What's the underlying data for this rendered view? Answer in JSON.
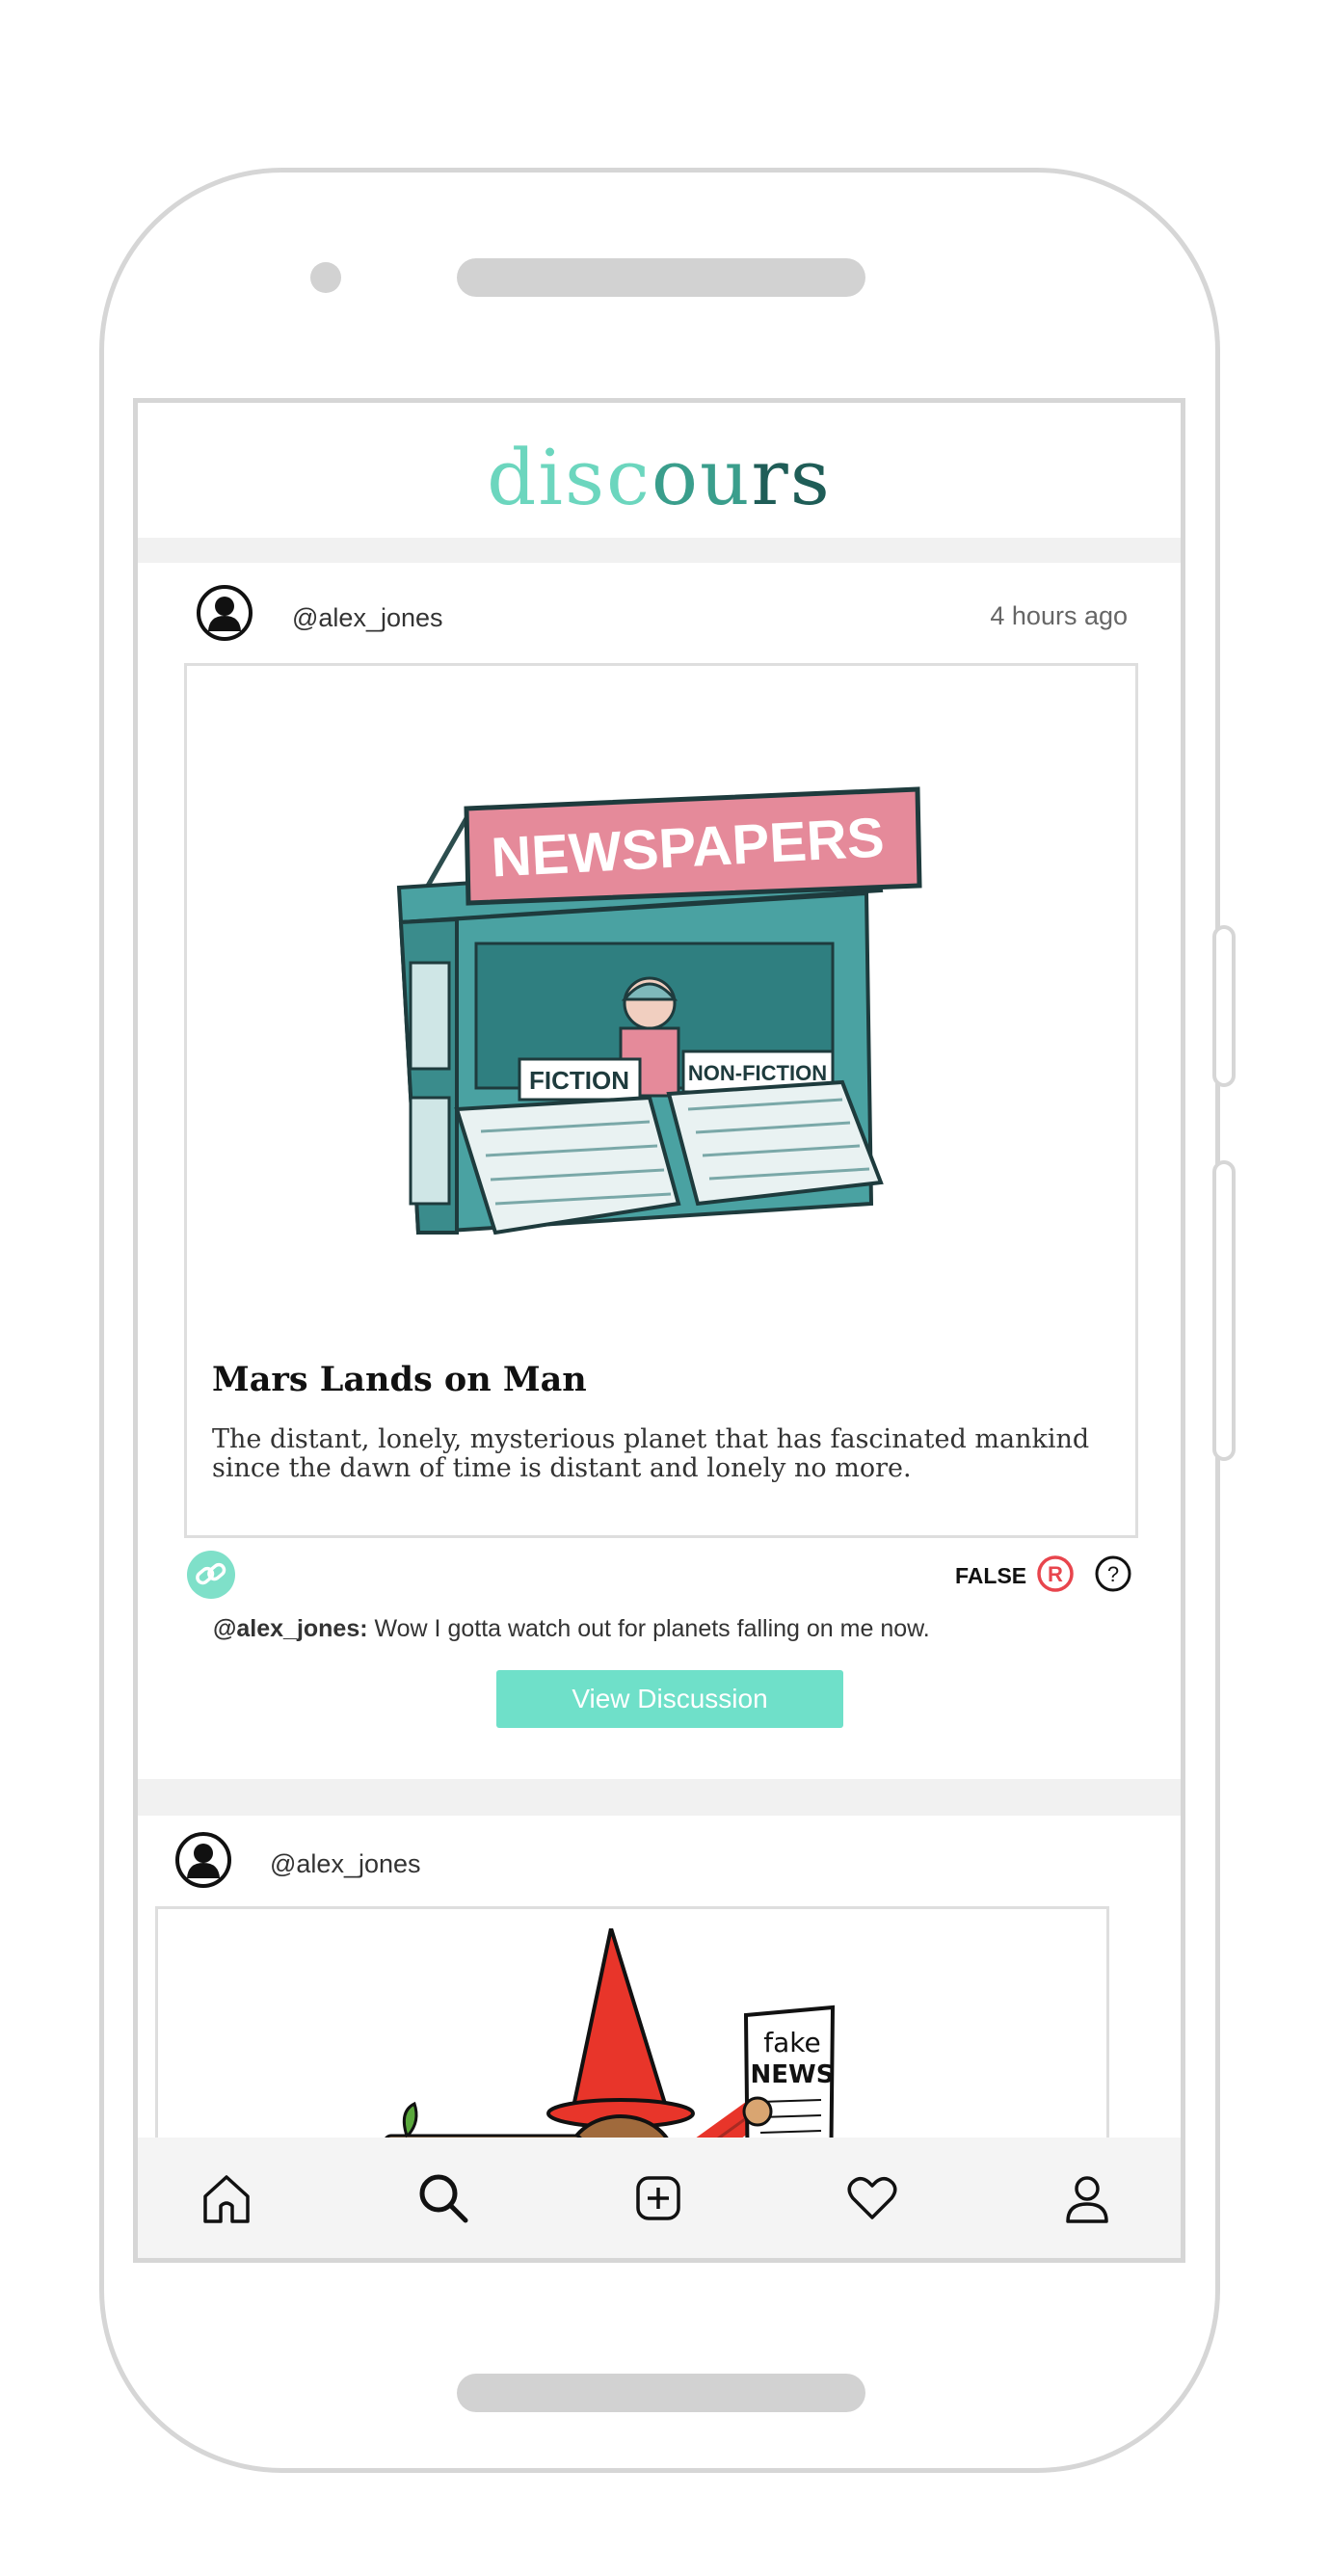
{
  "app": {
    "logo_part1": "disc",
    "logo_part2": "ou",
    "logo_part3": "rs"
  },
  "posts": [
    {
      "username": "@alex_jones",
      "time": "4 hours ago",
      "image_icon": "newspaper-stand-illustration",
      "image_text": {
        "sign": "NEWSPAPERS",
        "left": "FICTION",
        "right": "NON-FICTION"
      },
      "title": "Mars Lands on Man",
      "desc_line1": "The distant, lonely, mysterious planet that has fascinated mankind",
      "desc_line2": "since the dawn of time is distant and lonely no more.",
      "verdict": "FALSE",
      "verdict_icon": "registered-icon",
      "help_icon": "question-icon",
      "share_icon": "link-icon",
      "comment_user": "@alex_jones:",
      "comment_text": " Wow I gotta watch out for planets falling on me now.",
      "button_label": "View Discussion"
    },
    {
      "username": "@alex_jones",
      "image_icon": "pinocchio-fake-news-illustration",
      "image_text": {
        "line1": "fake",
        "line2": "NEWS"
      }
    }
  ],
  "nav": [
    {
      "icon": "home-icon"
    },
    {
      "icon": "search-icon"
    },
    {
      "icon": "add-icon"
    },
    {
      "icon": "heart-icon"
    },
    {
      "icon": "profile-icon"
    }
  ],
  "colors": {
    "accent": "#6fe0c9",
    "logo_light": "#6cd6be",
    "logo_mid": "#3a9e8c",
    "logo_dark": "#1f5d57",
    "verdict_red": "#e8454d"
  }
}
